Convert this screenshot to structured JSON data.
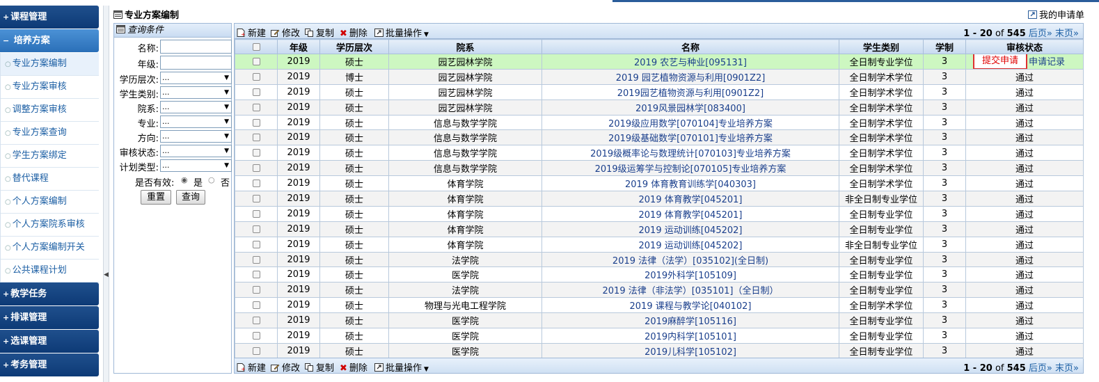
{
  "sidebar": {
    "groups": [
      {
        "label": "课程管理",
        "sign": "+"
      },
      {
        "label": "培养方案",
        "sign": "−"
      },
      {
        "label": "教学任务",
        "sign": "+"
      },
      {
        "label": "排课管理",
        "sign": "+"
      },
      {
        "label": "选课管理",
        "sign": "+"
      },
      {
        "label": "考务管理",
        "sign": "+"
      }
    ],
    "items": [
      "专业方案编制",
      "专业方案审核",
      "调整方案审核",
      "专业方案查询",
      "学生方案绑定",
      "替代课程",
      "个人方案编制",
      "个人方案院系审核",
      "个人方案编制开关",
      "公共课程计划"
    ]
  },
  "header": {
    "title": "专业方案编制",
    "my_apps": "我的申请单"
  },
  "query": {
    "title": "查询条件",
    "name_label": "名称:",
    "year_label": "年级:",
    "selects": [
      {
        "label": "学历层次:",
        "value": "..."
      },
      {
        "label": "学生类别:",
        "value": "..."
      },
      {
        "label": "院系:",
        "value": "..."
      },
      {
        "label": "专业:",
        "value": "..."
      },
      {
        "label": "方向:",
        "value": "..."
      },
      {
        "label": "审核状态:",
        "value": "..."
      },
      {
        "label": "计划类型:",
        "value": "..."
      }
    ],
    "valid_label": "是否有效:",
    "yes": "是",
    "no": "否",
    "reset": "重置",
    "search": "查询"
  },
  "toolbar": {
    "new": "新建",
    "edit": "修改",
    "copy": "复制",
    "delete": "删除",
    "batch": "批量操作",
    "pager_prefix": "1 - 20",
    "of": "of",
    "total": "545",
    "next": "后页»",
    "last": "末页»"
  },
  "table": {
    "headers": [
      "",
      "年级",
      "学历层次",
      "院系",
      "名称",
      "学生类别",
      "学制",
      "审核状态"
    ],
    "submit_label": "提交申请",
    "record_label": "申请记录",
    "rows": [
      [
        "2019",
        "硕士",
        "园艺园林学院",
        "2019 农艺与种业[095131]",
        "全日制专业学位",
        "3",
        ""
      ],
      [
        "2019",
        "博士",
        "园艺园林学院",
        "2019 园艺植物资源与利用[0901Z2]",
        "全日制学术学位",
        "3",
        "通过"
      ],
      [
        "2019",
        "硕士",
        "园艺园林学院",
        "2019园艺植物资源与利用[0901Z2]",
        "全日制学术学位",
        "3",
        "通过"
      ],
      [
        "2019",
        "硕士",
        "园艺园林学院",
        "2019风景园林学[083400]",
        "全日制学术学位",
        "3",
        "通过"
      ],
      [
        "2019",
        "硕士",
        "信息与数学学院",
        "2019级应用数学[070104]专业培养方案",
        "全日制学术学位",
        "3",
        "通过"
      ],
      [
        "2019",
        "硕士",
        "信息与数学学院",
        "2019级基础数学[070101]专业培养方案",
        "全日制学术学位",
        "3",
        "通过"
      ],
      [
        "2019",
        "硕士",
        "信息与数学学院",
        "2019级概率论与数理统计[070103]专业培养方案",
        "全日制学术学位",
        "3",
        "通过"
      ],
      [
        "2019",
        "硕士",
        "信息与数学学院",
        "2019级运筹学与控制论[070105]专业培养方案",
        "全日制学术学位",
        "3",
        "通过"
      ],
      [
        "2019",
        "硕士",
        "体育学院",
        "2019 体育教育训练学[040303]",
        "全日制学术学位",
        "3",
        "通过"
      ],
      [
        "2019",
        "硕士",
        "体育学院",
        "2019 体育教学[045201]",
        "非全日制专业学位",
        "3",
        "通过"
      ],
      [
        "2019",
        "硕士",
        "体育学院",
        "2019 体育教学[045201]",
        "全日制专业学位",
        "3",
        "通过"
      ],
      [
        "2019",
        "硕士",
        "体育学院",
        "2019 运动训练[045202]",
        "全日制专业学位",
        "3",
        "通过"
      ],
      [
        "2019",
        "硕士",
        "体育学院",
        "2019 运动训练[045202]",
        "非全日制专业学位",
        "3",
        "通过"
      ],
      [
        "2019",
        "硕士",
        "法学院",
        "2019 法律（法学）[035102](全日制)",
        "全日制专业学位",
        "3",
        "通过"
      ],
      [
        "2019",
        "硕士",
        "医学院",
        "2019外科学[105109]",
        "全日制专业学位",
        "3",
        "通过"
      ],
      [
        "2019",
        "硕士",
        "法学院",
        "2019 法律（非法学）[035101]（全日制）",
        "全日制专业学位",
        "3",
        "通过"
      ],
      [
        "2019",
        "硕士",
        "物理与光电工程学院",
        "2019 课程与教学论[040102]",
        "全日制学术学位",
        "3",
        "通过"
      ],
      [
        "2019",
        "硕士",
        "医学院",
        "2019麻醉学[105116]",
        "全日制专业学位",
        "3",
        "通过"
      ],
      [
        "2019",
        "硕士",
        "医学院",
        "2019内科学[105101]",
        "全日制专业学位",
        "3",
        "通过"
      ],
      [
        "2019",
        "硕士",
        "医学院",
        "2019儿科学[105102]",
        "全日制专业学位",
        "3",
        "通过"
      ]
    ]
  },
  "colors": {
    "nav": "#0d3a76",
    "highlight_row": "#cdf7c1",
    "submit_border": "#e03030"
  }
}
